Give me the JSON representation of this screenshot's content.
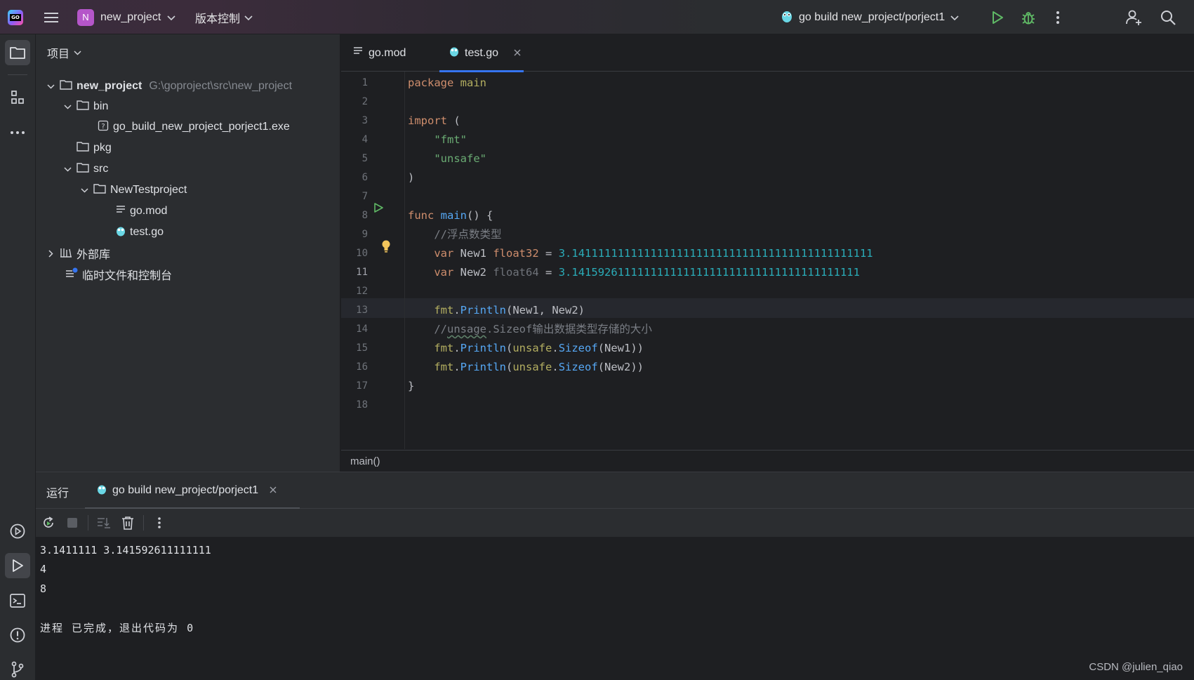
{
  "titlebar": {
    "project_initial": "N",
    "project_name": "new_project",
    "vcs_label": "版本控制",
    "run_config": "go build new_project/porject1"
  },
  "project_panel": {
    "header": "项目",
    "tree": [
      {
        "label": "new_project",
        "path": "G:\\goproject\\src\\new_project"
      },
      {
        "label": "bin"
      },
      {
        "label": "go_build_new_project_porject1.exe"
      },
      {
        "label": "pkg"
      },
      {
        "label": "src"
      },
      {
        "label": "NewTestproject"
      },
      {
        "label": "go.mod"
      },
      {
        "label": "test.go"
      },
      {
        "label": "外部库"
      },
      {
        "label": "临时文件和控制台"
      }
    ]
  },
  "editor": {
    "tabs": [
      {
        "label": "go.mod",
        "active": false
      },
      {
        "label": "test.go",
        "active": true
      }
    ],
    "current_line": 11,
    "code": {
      "l1_kw": "package",
      "l1_name": "main",
      "l3_kw": "import",
      "l3_paren": "(",
      "l4": "\"fmt\"",
      "l5": "\"unsafe\"",
      "l6": ")",
      "l8_kw": "func",
      "l8_fn": "main",
      "l8_rest": "() {",
      "l9": "//浮点数类型",
      "l10_kw": "var",
      "l10_name": "New1",
      "l10_type": "float32",
      "l10_eq": "=",
      "l10_val": "3.1411111111111111111111111111111111111111111111",
      "l11_kw": "var",
      "l11_name": "New2",
      "l11_type": "float64",
      "l11_eq": "=",
      "l11_val": "3.14159261111111111111111111111111111111111111",
      "l13_pkg": "fmt",
      "l13_fn": "Println",
      "l13_args": "(New1, New2)",
      "l14_pre": "//",
      "l14_typo": "unsage",
      "l14_rest": ".Sizeof输出数据类型存储的大小",
      "l15_pkg": "fmt",
      "l15_fn": "Println",
      "l15_mid": "unsafe",
      "l15_fn2": "Sizeof",
      "l15_args": "(New1))",
      "l16_pkg": "fmt",
      "l16_fn": "Println",
      "l16_mid": "unsafe",
      "l16_fn2": "Sizeof",
      "l16_args": "(New2))",
      "l17": "}"
    },
    "line_numbers": [
      "1",
      "2",
      "3",
      "4",
      "5",
      "6",
      "7",
      "8",
      "9",
      "10",
      "11",
      "12",
      "13",
      "14",
      "15",
      "16",
      "17",
      "18"
    ],
    "breadcrumb": "main()"
  },
  "run_panel": {
    "title": "运行",
    "tab_label": "go build new_project/porject1",
    "output": [
      "3.1411111 3.141592611111111",
      "4",
      "8",
      "",
      "进程 已完成，退出代码为 0"
    ]
  },
  "watermark": "CSDN @julien_qiao",
  "colors": {
    "accent": "#3574f0",
    "keyword": "#cf8e6d",
    "function": "#56a8f5",
    "string": "#6aab73",
    "number": "#2aacb8",
    "run_green": "#5fb865",
    "project_badge": "#b556c9"
  },
  "icons": [
    "app-logo-icon",
    "hamburger-menu-icon",
    "chevron-down-icon",
    "gopher-icon",
    "run-icon",
    "debug-icon",
    "more-vertical-icon",
    "add-user-icon",
    "search-icon",
    "folder-icon",
    "structure-icon",
    "more-horizontal-icon",
    "services-icon",
    "run-tool-icon",
    "terminal-icon",
    "problems-icon",
    "git-icon",
    "file-lines-icon",
    "close-icon",
    "rerun-icon",
    "stop-icon",
    "scroll-to-end-icon",
    "trash-icon",
    "library-icon",
    "scratch-icon",
    "intention-bulb-icon",
    "unknown-file-icon"
  ]
}
